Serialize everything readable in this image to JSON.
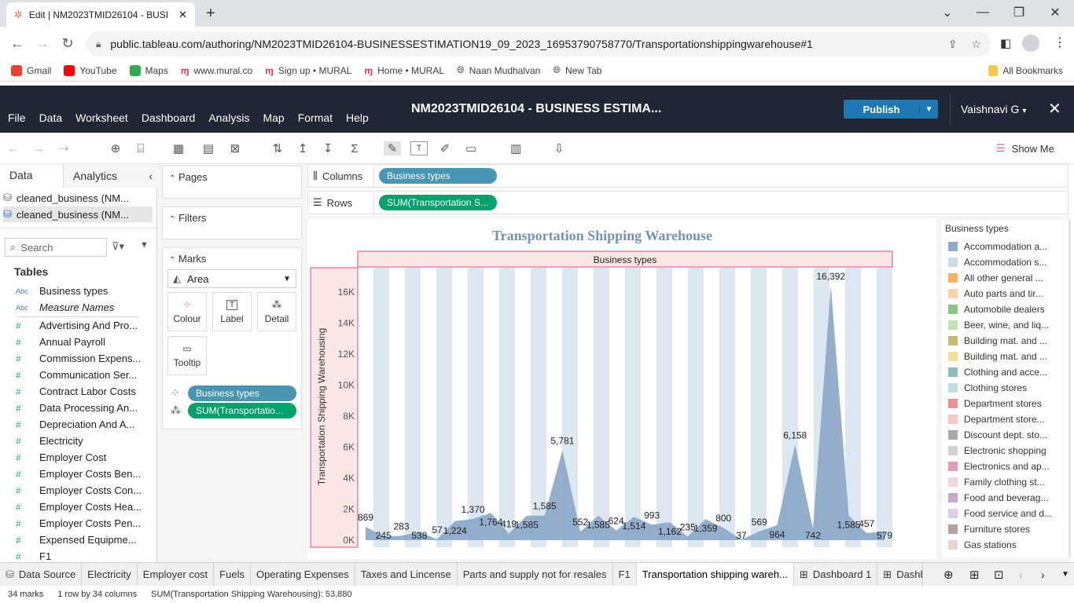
{
  "browser": {
    "tab_title": "Edit | NM2023TMID26104 - BUSI",
    "url": "public.tableau.com/authoring/NM2023TMID26104-BUSINESSESTIMATION19_09_2023_16953790758770/Transportationshippingwarehouse#1",
    "bookmarks": [
      {
        "label": "Gmail",
        "color": "#ea4335"
      },
      {
        "label": "YouTube",
        "color": "#ff0000"
      },
      {
        "label": "Maps",
        "color": "#34a853"
      },
      {
        "label": "www.mural.co",
        "color": "#e8344e"
      },
      {
        "label": "Sign up • MURAL",
        "color": "#e8344e"
      },
      {
        "label": "Home • MURAL",
        "color": "#e8344e"
      },
      {
        "label": "Naan Mudhalvan",
        "color": "#444444"
      },
      {
        "label": "New Tab",
        "color": "#444444"
      }
    ],
    "all_bookmarks": "All Bookmarks"
  },
  "tableau": {
    "menu": [
      "File",
      "Data",
      "Worksheet",
      "Dashboard",
      "Analysis",
      "Map",
      "Format",
      "Help"
    ],
    "workbook_title": "NM2023TMID26104 - BUSINESS ESTIMA...",
    "publish": "Publish",
    "user": "Vaishnavi G",
    "show_me": "Show Me"
  },
  "left_panel": {
    "tab_data": "Data",
    "tab_analytics": "Analytics",
    "datasources": [
      "cleaned_business (NM...",
      "cleaned_business (NM..."
    ],
    "search_placeholder": "Search",
    "tables_heading": "Tables",
    "dim_fields": [
      "Business types",
      "Measure Names"
    ],
    "measure_fields": [
      "Advertising And Pro...",
      "Annual Payroll",
      "Commission Expens...",
      "Communication Ser...",
      "Contract Labor Costs",
      "Data Processing An...",
      "Depreciation And A...",
      "Electricity",
      "Employer Cost",
      "Employer Costs Ben...",
      "Employer Costs Con...",
      "Employer Costs Hea...",
      "Employer Costs Pen...",
      "Expensed Equipme...",
      "F1"
    ]
  },
  "shelves": {
    "pages": "Pages",
    "filters": "Filters",
    "marks": "Marks",
    "mark_type": "Area",
    "colour": "Colour",
    "label": "Label",
    "detail": "Detail",
    "tooltip": "Tooltip",
    "marks_pill_1": "Business types",
    "marks_pill_2": "SUM(Transportatio...",
    "columns_label": "Columns",
    "rows_label": "Rows",
    "columns_pill": "Business types",
    "rows_pill": "SUM(Transportation S..."
  },
  "chart_data": {
    "type": "area",
    "title": "Transportation Shipping Warehouse",
    "header": "Business types",
    "ylabel": "Transportation Shipping Warehousing",
    "ylim": [
      0,
      17000
    ],
    "yticks": [
      "0K",
      "2K",
      "4K",
      "6K",
      "8K",
      "10K",
      "12K",
      "14K",
      "16K"
    ],
    "values": [
      869,
      245,
      283,
      538,
      57,
      1224,
      1370,
      1764,
      419,
      1585,
      1585,
      5781,
      552,
      1585,
      624,
      1514,
      993,
      1162,
      235,
      1359,
      800,
      37,
      569,
      964,
      6158,
      742,
      16392,
      1585,
      457,
      579
    ],
    "colors": {
      "fill": "#8faac9",
      "band": "#dbe8f1",
      "stroke": "#e34a8a",
      "header_bg": "#fae6e3"
    }
  },
  "legend": {
    "title": "Business types",
    "items": [
      {
        "label": "Accommodation a...",
        "color": "#8faacb"
      },
      {
        "label": "Accommodation s...",
        "color": "#c9dcec"
      },
      {
        "label": "All other general ...",
        "color": "#f7b26a"
      },
      {
        "label": "Auto parts and tir...",
        "color": "#fbd3a9"
      },
      {
        "label": "Automobile dealers",
        "color": "#8fc386"
      },
      {
        "label": "Beer, wine, and liq...",
        "color": "#bfe3b5"
      },
      {
        "label": "Building mat. and ...",
        "color": "#c9b870"
      },
      {
        "label": "Building mat. and ...",
        "color": "#f5df9a"
      },
      {
        "label": "Clothing and acce...",
        "color": "#8bbdbd"
      },
      {
        "label": "Clothing stores",
        "color": "#c0dede"
      },
      {
        "label": "Department stores",
        "color": "#ef8f8f"
      },
      {
        "label": "Department store...",
        "color": "#f9c6c6"
      },
      {
        "label": "Discount dept. sto...",
        "color": "#a8a8a8"
      },
      {
        "label": "Electronic shopping",
        "color": "#d2d2d2"
      },
      {
        "label": "Electronics and ap...",
        "color": "#e89ab9"
      },
      {
        "label": "Family clothing st...",
        "color": "#f7d3e1"
      },
      {
        "label": "Food and beverag...",
        "color": "#c8a7cf"
      },
      {
        "label": "Food service and d...",
        "color": "#e2cbe6"
      },
      {
        "label": "Furniture stores",
        "color": "#b9a29d"
      },
      {
        "label": "Gas stations",
        "color": "#e7d3cf"
      }
    ]
  },
  "sheet_tabs": [
    "Data Source",
    "Electricity",
    "Employer cost",
    "Fuels",
    "Operating Expenses",
    "Taxes and Lincense",
    "Parts and supply not for resales",
    "F1",
    "Transportation shipping wareh...",
    "Dashboard 1",
    "Dashboard"
  ],
  "status": {
    "marks": "34 marks",
    "dims": "1 row by 34 columns",
    "sum": "SUM(Transportation Shipping Warehousing): 53,880"
  }
}
